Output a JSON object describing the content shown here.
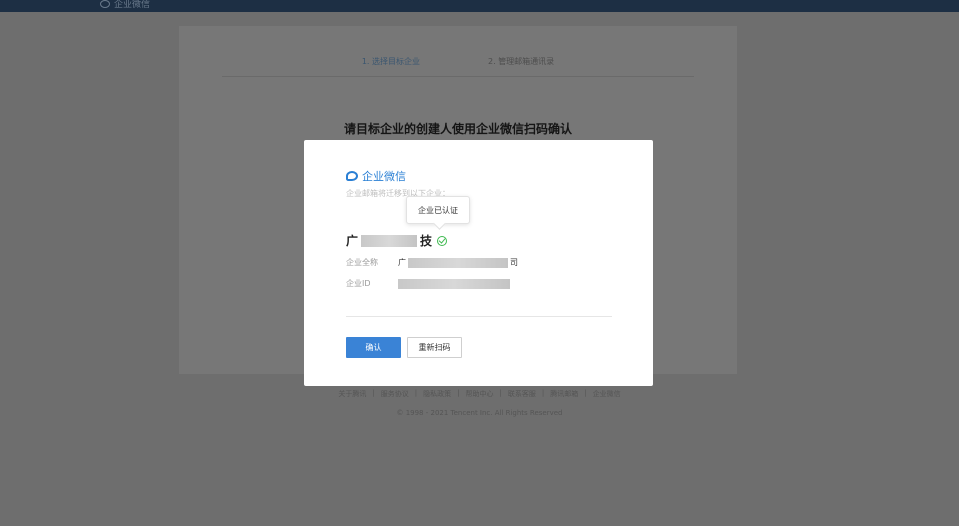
{
  "topbar": {
    "app_name": "企业微信"
  },
  "steps": {
    "step1": "1. 选择目标企业",
    "step2": "2. 管理邮箱通讯录"
  },
  "background": {
    "heading": "请目标企业的创建人使用企业微信扫码确认"
  },
  "footer": {
    "links": [
      "关于腾讯",
      "服务协议",
      "隐私政策",
      "帮助中心",
      "联系客服",
      "腾讯邮箱",
      "企业微信"
    ],
    "copyright": "© 1998 - 2021 Tencent Inc. All Rights Reserved"
  },
  "modal": {
    "brand": "企业微信",
    "hint": "企业邮箱将迁移到以下企业：",
    "tooltip": "企业已认证",
    "company_first": "广",
    "company_last": "技",
    "full_name_label": "企业全称",
    "full_name_first": "广",
    "full_name_last": "司",
    "id_label": "企业ID",
    "confirm_label": "确认",
    "rescan_label": "重新扫码"
  }
}
